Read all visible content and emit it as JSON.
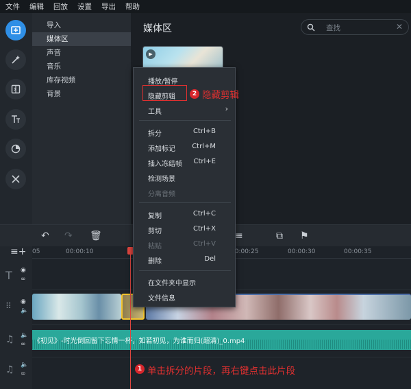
{
  "menubar": [
    "文件",
    "编辑",
    "回放",
    "设置",
    "导出",
    "帮助"
  ],
  "rail": {
    "icons": [
      "media-import-icon",
      "effects-wand-icon",
      "transitions-icon",
      "titles-icon",
      "stickers-icon",
      "tools-icon"
    ]
  },
  "nav": {
    "items": [
      {
        "label": "导入"
      },
      {
        "label": "媒体区"
      },
      {
        "label": "声音"
      },
      {
        "label": "音乐"
      },
      {
        "label": "库存视频"
      },
      {
        "label": "背景"
      }
    ]
  },
  "media": {
    "title": "媒体区",
    "search_placeholder": "查找"
  },
  "ruler": {
    "ticks": [
      "05",
      "00:00:10",
      "00:00:25",
      "00:00:30",
      "00:00:35"
    ]
  },
  "context_menu": {
    "play_pause": "播放/暂停",
    "hide_clip": "隐藏剪辑",
    "tools": "工具",
    "split": "拆分",
    "split_sc": "Ctrl+B",
    "add_marker": "添加标记",
    "add_marker_sc": "Ctrl+M",
    "freeze_frame": "插入冻结帧",
    "freeze_frame_sc": "Ctrl+E",
    "detect_scenes": "检测场景",
    "detach_audio": "分离音频",
    "copy": "复制",
    "copy_sc": "Ctrl+C",
    "cut": "剪切",
    "cut_sc": "Ctrl+X",
    "paste": "粘贴",
    "paste_sc": "Ctrl+V",
    "delete": "删除",
    "delete_sc": "Del",
    "show_in_folder": "在文件夹中显示",
    "file_info": "文件信息"
  },
  "audio_clip": {
    "label": "《初见》-时光倒回留下忘情一杯，如若初见，为谁而归(超清)_0.mp4"
  },
  "annotations": {
    "step1_num": "1",
    "step1_text": "单击拆分的片段，再右键点击此片段",
    "step2_num": "2",
    "step2_text": "隐藏剪辑"
  },
  "colors": {
    "accent": "#2f8fe6",
    "annotation_red": "#e03030",
    "audio_clip": "#2aa89a",
    "selected_clip_border": "#f3c42f",
    "playhead": "#e0463f"
  }
}
